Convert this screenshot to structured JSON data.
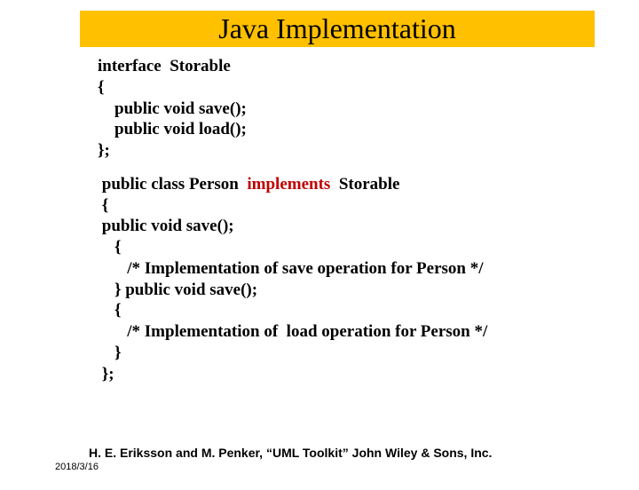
{
  "title": "Java Implementation",
  "code": {
    "l1": "interface  Storable",
    "l2": "{",
    "l3": "    public void save();",
    "l4": "    public void load();",
    "l5": "};",
    "l6": " public class Person  ",
    "l6_kw": "implements",
    "l6_after": "  Storable",
    "l7": " {",
    "l8": " public void save();",
    "l9": "    {",
    "l10": "       /* Implementation of save operation for Person */",
    "l11": "    } public void save();",
    "l12": "    {",
    "l13": "       /* Implementation of  load operation for Person */",
    "l14": "    }",
    "l15": " };"
  },
  "footer": {
    "citation": "H. E. Eriksson and M. Penker, “UML Toolkit” John Wiley & Sons, Inc.",
    "date": "2018/3/16"
  }
}
